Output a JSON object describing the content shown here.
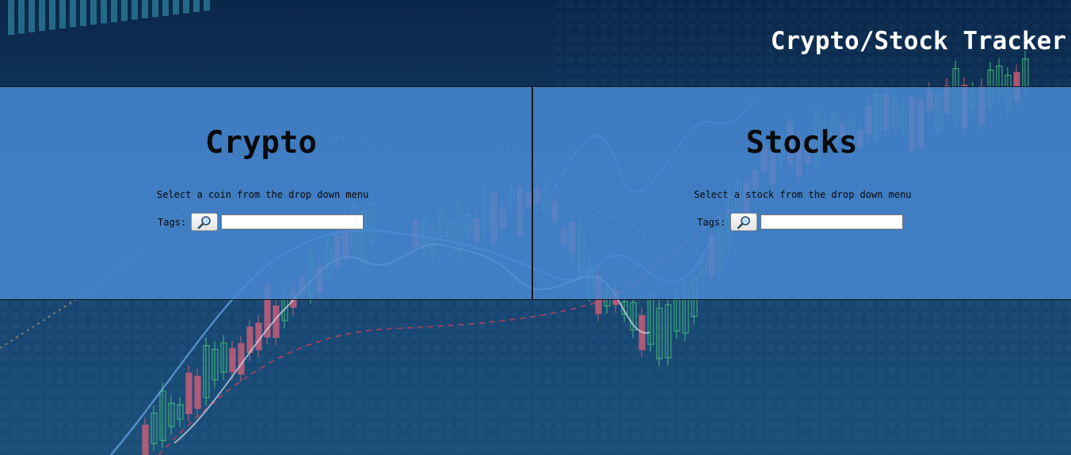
{
  "header": {
    "title": "Crypto/Stock Tracker"
  },
  "crypto_panel": {
    "title": "Crypto",
    "instruction": "Select a coin from the drop down menu",
    "tags_label": "Tags:",
    "search_icon": "magnifier-icon",
    "tags_value": ""
  },
  "stocks_panel": {
    "title": "Stocks",
    "instruction": "Select a stock from the drop down menu",
    "tags_label": "Tags:",
    "search_icon": "magnifier-icon",
    "tags_value": ""
  },
  "colors": {
    "background": "#0f2f55",
    "panel": "#4888d2",
    "title_text": "#ffffff",
    "panel_text": "#0a0a0a",
    "candle_up": "#46c27a",
    "candle_down": "#d2607a"
  }
}
